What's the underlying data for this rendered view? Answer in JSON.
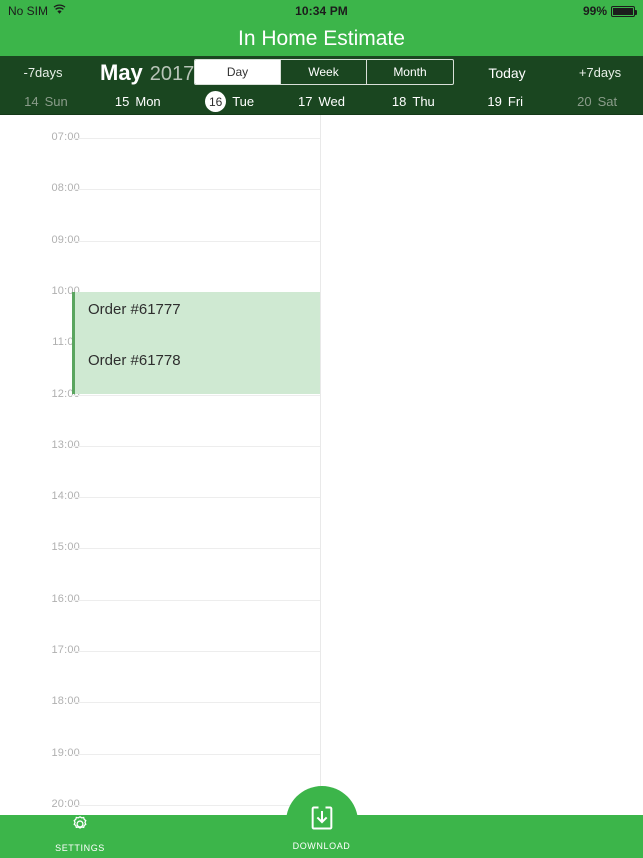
{
  "status_bar": {
    "carrier": "No SIM",
    "wifi_icon": "wifi-icon",
    "time": "10:34 PM",
    "battery_percent": "99%",
    "battery_icon": "battery-full-icon"
  },
  "title_bar": {
    "title": "In Home Estimate"
  },
  "nav_bar": {
    "prev_label": "-7days",
    "month": "May",
    "year": "2017",
    "segments": [
      {
        "label": "Day",
        "selected": true
      },
      {
        "label": "Week",
        "selected": false
      },
      {
        "label": "Month",
        "selected": false
      }
    ],
    "today_label": "Today",
    "next_label": "+7days"
  },
  "days": [
    {
      "num": "14",
      "name": "Sun",
      "selected": false,
      "dim": true
    },
    {
      "num": "15",
      "name": "Mon",
      "selected": false,
      "dim": false
    },
    {
      "num": "16",
      "name": "Tue",
      "selected": true,
      "dim": false
    },
    {
      "num": "17",
      "name": "Wed",
      "selected": false,
      "dim": false
    },
    {
      "num": "18",
      "name": "Thu",
      "selected": false,
      "dim": false
    },
    {
      "num": "19",
      "name": "Fri",
      "selected": false,
      "dim": false
    },
    {
      "num": "20",
      "name": "Sat",
      "selected": false,
      "dim": true
    }
  ],
  "calendar": {
    "hours": [
      "07:00",
      "08:00",
      "09:00",
      "10:00",
      "11:00",
      "12:00",
      "13:00",
      "14:00",
      "15:00",
      "16:00",
      "17:00",
      "18:00",
      "19:00",
      "20:00"
    ],
    "events": [
      {
        "title": "Order #61777",
        "start": "10:00",
        "end": "11:00"
      },
      {
        "title": "Order #61778",
        "start": "11:00",
        "end": "12:00"
      }
    ]
  },
  "tab_bar": {
    "items": [
      {
        "label": "SETTINGS",
        "icon": "gear-icon"
      },
      {
        "label": "DOWNLOAD",
        "icon": "download-icon"
      }
    ]
  },
  "colors": {
    "brand_green": "#3cb54a",
    "dark_green": "#1a4620",
    "event_fill": "#cfe9d2",
    "event_border": "#5aa55f"
  }
}
